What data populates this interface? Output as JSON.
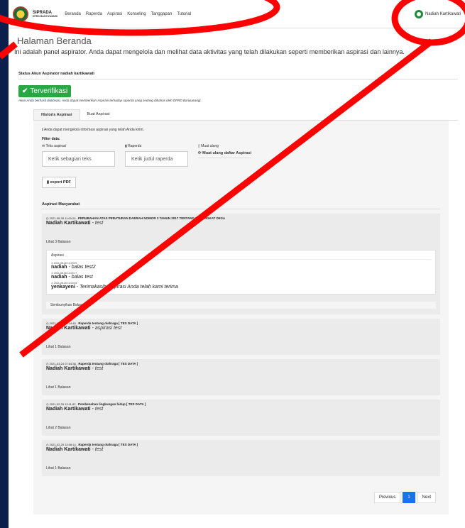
{
  "navbar": {
    "brand_title": "SIPRADA",
    "brand_sub": "DPRD BANYUWANGI",
    "links": [
      "Beranda",
      "Raperda",
      "Aspirasi",
      "Konseling",
      "Tanggapan",
      "Tutorial"
    ],
    "user_name": "Nadiah Kartikawati"
  },
  "header": {
    "title": "Halaman Beranda",
    "description": "Ini adalah panel aspirator. Anda dapat mengelola dan melihat data aktivitas yang telah dilakukan seperti memberikan aspirasi dan lainnya."
  },
  "status": {
    "label": "Status Akun Aspirator nadiah kartikawati",
    "badge": "Terverifikasi",
    "note": "Akun Anda berhasil diaktivasi, Anda dapat memberikan Aspirasi terhadap raperda yang sedang dibahas oleh DPRD Banyuwangi."
  },
  "tabs": [
    "Historis Aspirasi",
    "Buat Aspirasi"
  ],
  "panel": {
    "info": "Anda dapat mengelola informasi aspirasi yang telah Anda kirim.",
    "filter_label": "Filter data:",
    "filter_text_head": "Teks aspirasi",
    "filter_text_placeholder": "Ketik sebagian teks",
    "filter_raperda_head": "Raperda",
    "filter_raperda_placeholder": "Ketik judul raperda",
    "reload_head": "Muat ulang",
    "reload_link": "Muat ulang daftar Aspirasi",
    "export": "export PDF",
    "section_title": "Aspirasi Masyarakat"
  },
  "aspirations": [
    {
      "date": "2021-08-30 11:00:29",
      "raperda": "PERUBAHAN ATAS PERATURAN DAERAH NOMOR 3 TAHUN 2017 TENTANG PERANGKAT DESA",
      "author": "Nadiah Kartikawati",
      "text": "test",
      "replies_link": "Lihat 3 Balasan",
      "replies_title": "Aspirasi",
      "replies": [
        {
          "date": "2021-08-30 11:00:29",
          "author": "nadiah",
          "text": "balas test2"
        },
        {
          "date": "2021-08-30 11:00:17",
          "author": "nadiah",
          "text": "balas test"
        },
        {
          "date": "2021-08-30 11:00:04",
          "author": "yenkayeni",
          "text": "Terimakasih, aspirasi Anda telah kami terima"
        }
      ],
      "hide_link": "Sembunyikan Balasan"
    },
    {
      "date": "2021-04-29 14:14:40",
      "raperda": "Raperda tentang olahraga [ TES DATA ]",
      "author": "Nadiah Kartikawati",
      "text": "aspirasi test",
      "replies_link": "Lihat 1 Balasan"
    },
    {
      "date": "2021-03-24 07:54:38",
      "raperda": "Raperda tentang olahraga [ TES DATA ]",
      "author": "Nadiah Kartikawati",
      "text": "test",
      "replies_link": "Lihat 1 Balasan"
    },
    {
      "date": "2021-02-25 13:11:52",
      "raperda": "Pembenahan lingkungan hidup [ TES DATA ]",
      "author": "Nadiah Kartikawati",
      "text": "test",
      "replies_link": "Lihat 2 Balasan"
    },
    {
      "date": "2021-02-25 13:08:14",
      "raperda": "Raperda tentang olahraga [ TES DATA ]",
      "author": "Nadiah Kartikawati",
      "text": "test",
      "replies_link": "Lihat 1 Balasan"
    }
  ],
  "pagination": {
    "previous": "Previous",
    "current": "1",
    "next": "Next"
  },
  "colors": {
    "annotation": "#ff0000",
    "verified": "#28a745",
    "active_page": "#1a73e8"
  }
}
